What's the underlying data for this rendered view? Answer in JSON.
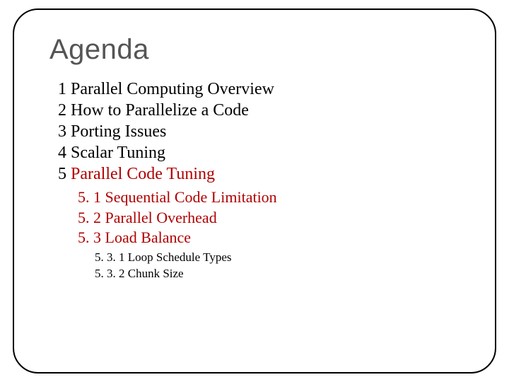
{
  "title": "Agenda",
  "items": [
    {
      "num": "1",
      "text": "Parallel Computing Overview",
      "highlight": false
    },
    {
      "num": "2",
      "text": "How to Parallelize a Code",
      "highlight": false
    },
    {
      "num": "3",
      "text": "Porting Issues",
      "highlight": false
    },
    {
      "num": "4",
      "text": "Scalar Tuning",
      "highlight": false
    },
    {
      "num": "5",
      "text": "Parallel Code Tuning",
      "highlight": true
    }
  ],
  "sub": [
    {
      "num": "5. 1",
      "text": "Sequential Code Limitation"
    },
    {
      "num": "5. 2",
      "text": "Parallel Overhead"
    },
    {
      "num": "5. 3",
      "text": "Load Balance"
    }
  ],
  "subsub": [
    {
      "num": "5. 3. 1",
      "text": "Loop Schedule Types"
    },
    {
      "num": "5. 3. 2",
      "text": "Chunk Size"
    }
  ]
}
